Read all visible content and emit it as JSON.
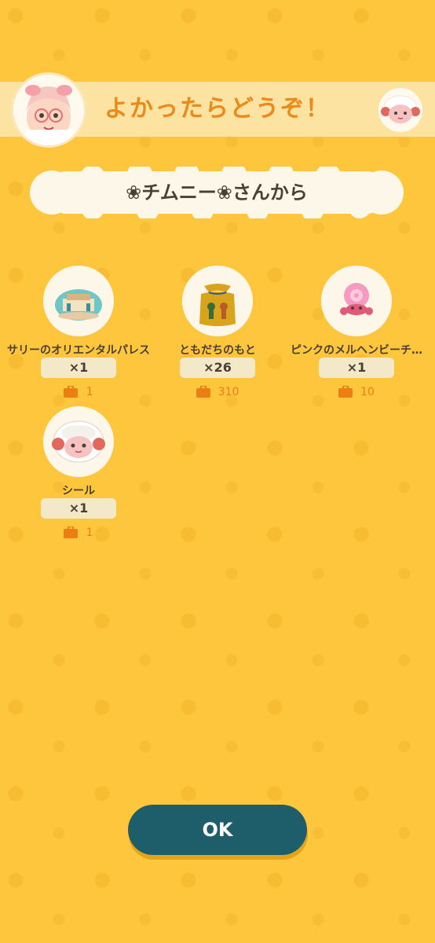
{
  "header": {
    "title": "よかったらどうぞ！"
  },
  "sender": {
    "label": "❀チムニー❀さんから"
  },
  "gifts": [
    {
      "name": "サリーのオリエンタルパレス",
      "quantity": "×1",
      "bag_count": "1",
      "icon": "oriental-palace-icon"
    },
    {
      "name": "ともだちのもと",
      "quantity": "×26",
      "bag_count": "310",
      "icon": "friend-powder-bag-icon"
    },
    {
      "name": "ピンクのメルヘンビーチ…",
      "quantity": "×1",
      "bag_count": "10",
      "icon": "pink-hermit-crab-icon"
    },
    {
      "name": "シール",
      "quantity": "×1",
      "bag_count": "1",
      "icon": "sheep-sticker-icon"
    }
  ],
  "ok_button": {
    "label": "OK"
  },
  "colors": {
    "background": "#FDC63D",
    "banner": "#FCE3A2",
    "title": "#EB8A1A",
    "button": "#1E5E6B",
    "bag_count": "#EB7F14"
  }
}
